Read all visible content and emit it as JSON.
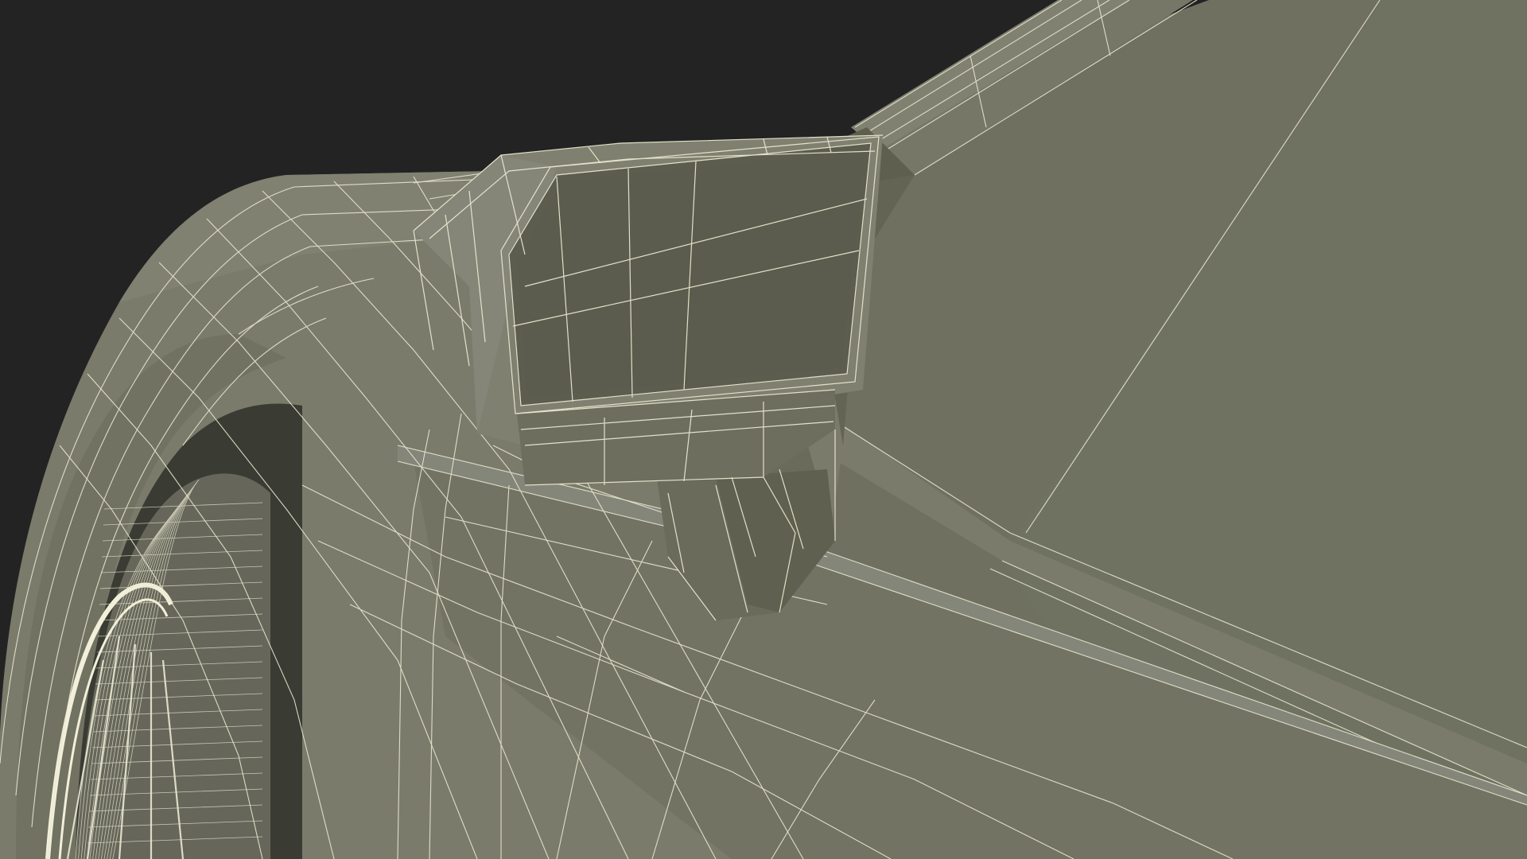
{
  "scene": {
    "subject": "wireframe-render",
    "colors": {
      "background": "#232323",
      "surface_light": "#7b7c6c",
      "surface_mid": "#6f705f",
      "surface_dark": "#5f604f",
      "mirror_face": "#5c5d4e",
      "tire": "#66675a",
      "wire": "#e9e8d0",
      "rim": "#f2f0da"
    }
  }
}
